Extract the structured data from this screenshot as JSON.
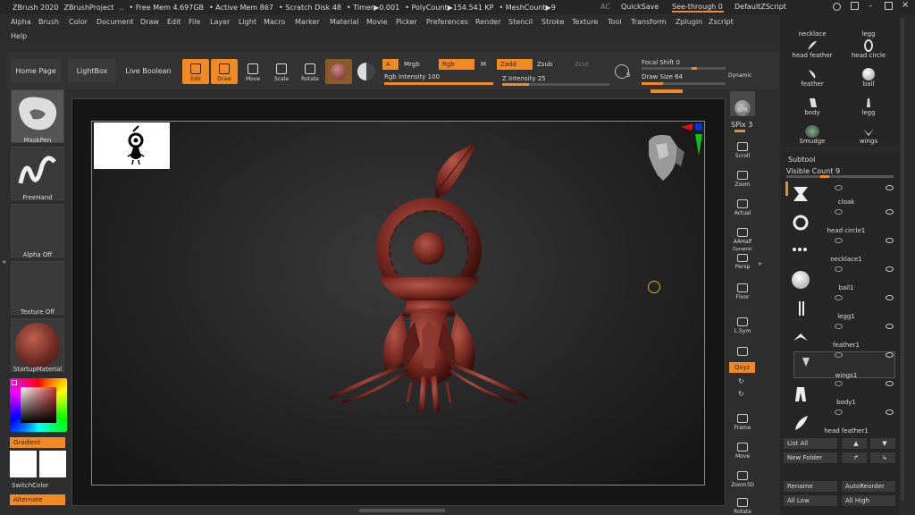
{
  "titlebar": {
    "app": "ZBrush 2020",
    "project": "ZBrushProject",
    "dots": "..",
    "free_mem": "• Free Mem 4.697GB",
    "active_mem": "• Active Mem 867",
    "scratch": "• Scratch Disk 48",
    "timer": "• Timer▶0.001",
    "polycount": "• PolyCount▶154.541 KP",
    "meshcount": "• MeshCount▶9",
    "ac": "AC",
    "quicksave": "QuickSave",
    "seethrough": "See-through  0",
    "script": "DefaultZScript"
  },
  "menus": [
    "Alpha",
    "Brush",
    "Color",
    "Document",
    "Draw",
    "Edit",
    "File",
    "Layer",
    "Light",
    "Macro",
    "Marker",
    "Material",
    "Movie",
    "Picker",
    "Preferences",
    "Render",
    "Stencil",
    "Stroke",
    "Texture",
    "Tool",
    "Transform",
    "Zplugin",
    "Zscript"
  ],
  "help": "Help",
  "shelf": {
    "home": "Home Page",
    "lightbox": "LightBox",
    "liveboolean": "Live Boolean",
    "edit": "Edit",
    "draw": "Draw",
    "move": "Move",
    "scale": "Scale",
    "rotate": "Rotate",
    "a": "A",
    "mrgb": "Mrgb",
    "rgb": "Rgb",
    "m": "M",
    "zadd": "Zadd",
    "zsub": "Zsub",
    "zcut": "Zcut",
    "rgb_intensity": "Rgb Intensity 100",
    "z_intensity": "Z Intensity 25",
    "focal_shift": "Focal Shift 0",
    "draw_size": "Draw Size 64",
    "dynamic": "Dynamic",
    "s": "S",
    "rgb_intensity_value": 100,
    "z_intensity_value": 25
  },
  "left": {
    "brush": "MaskPen",
    "stroke": "FreeHand",
    "alpha": "Alpha Off",
    "texture": "Texture Off",
    "material": "StartupMaterial",
    "gradient": "Gradient",
    "switchcolor": "SwitchColor",
    "alternate": "Alternate"
  },
  "righttools": {
    "bpr": "BPR",
    "spix": "SPix 3",
    "scroll": "Scroll",
    "zoom": "Zoom",
    "actual": "Actual",
    "aahalf": "AAHalf",
    "dynamic": "Dynamic",
    "persp": "Persp",
    "floor": "Floor",
    "lsym": "L.Sym",
    "xyz": "Qxyz",
    "frame": "Frame",
    "move": "Move",
    "zoom3d": "Zoom3D",
    "rotate": "Rotate"
  },
  "brushes": [
    "necklace",
    "legg",
    "head feather",
    "head circle",
    "feather",
    "ball",
    "body",
    "legg",
    "Smudge",
    "wings"
  ],
  "subtool": {
    "title": "Subtool",
    "visible_count": "Visible Count 9",
    "items": [
      "cloak",
      "head circle1",
      "necklace1",
      "ball1",
      "legg1",
      "feather1",
      "wings1",
      "body1",
      "head feather1"
    ],
    "list_all": "List All",
    "new_folder": "New Folder",
    "rename": "Rename",
    "autoreorder": "AutoReorder",
    "all_low": "All Low",
    "all_high": "All High"
  },
  "colors": {
    "accent": "#f08a24",
    "model": "#7a2a22"
  }
}
